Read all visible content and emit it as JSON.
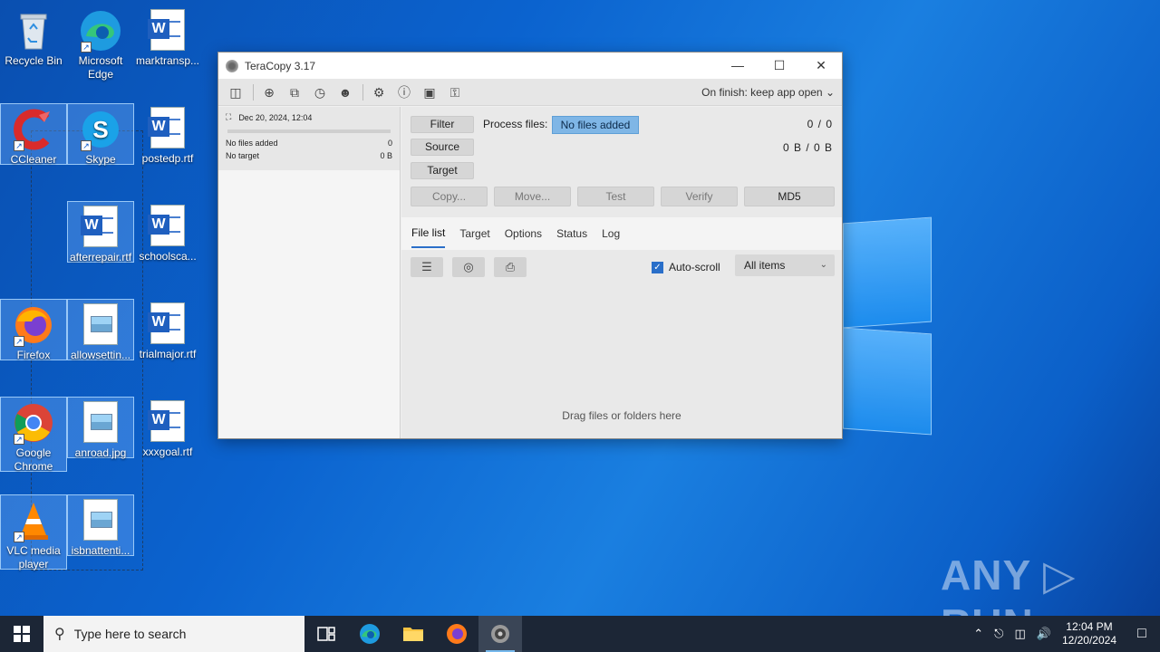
{
  "desktop": {
    "icons": [
      {
        "label": "Recycle Bin"
      },
      {
        "label": "Microsoft Edge"
      },
      {
        "label": "marktransp..."
      },
      {
        "label": "CCleaner"
      },
      {
        "label": "Skype"
      },
      {
        "label": "postedp.rtf"
      },
      {
        "label": "afterrepair.rtf"
      },
      {
        "label": "schoolsca..."
      },
      {
        "label": "Firefox"
      },
      {
        "label": "allowsettin..."
      },
      {
        "label": "trialmajor.rtf"
      },
      {
        "label": "Google Chrome"
      },
      {
        "label": "anroad.jpg"
      },
      {
        "label": "xxxgoal.rtf"
      },
      {
        "label": "VLC media player"
      },
      {
        "label": "isbnattenti..."
      }
    ]
  },
  "window": {
    "title": "TeraCopy 3.17",
    "toolbar": {
      "on_finish": "On finish: keep app open"
    },
    "job": {
      "date": "Dec 20, 2024, 12:04",
      "files_label": "No files added",
      "files_count": "0",
      "target_label": "No target",
      "target_size": "0 B"
    },
    "actions": {
      "filter": "Filter",
      "source": "Source",
      "target": "Target",
      "process_files_label": "Process files:",
      "process_files_value": "No files added",
      "count": "0 / 0",
      "size": "0 B / 0 B",
      "copy": "Copy...",
      "move": "Move...",
      "test": "Test",
      "verify": "Verify",
      "md5": "MD5"
    },
    "tabs": [
      "File list",
      "Target",
      "Options",
      "Status",
      "Log"
    ],
    "list": {
      "autoscroll": "Auto-scroll",
      "filter_value": "All items",
      "empty_text": "Drag files or folders here"
    }
  },
  "watermark": "ANY ▷ RUN",
  "taskbar": {
    "search_placeholder": "Type here to search",
    "time": "12:04 PM",
    "date": "12/20/2024"
  }
}
